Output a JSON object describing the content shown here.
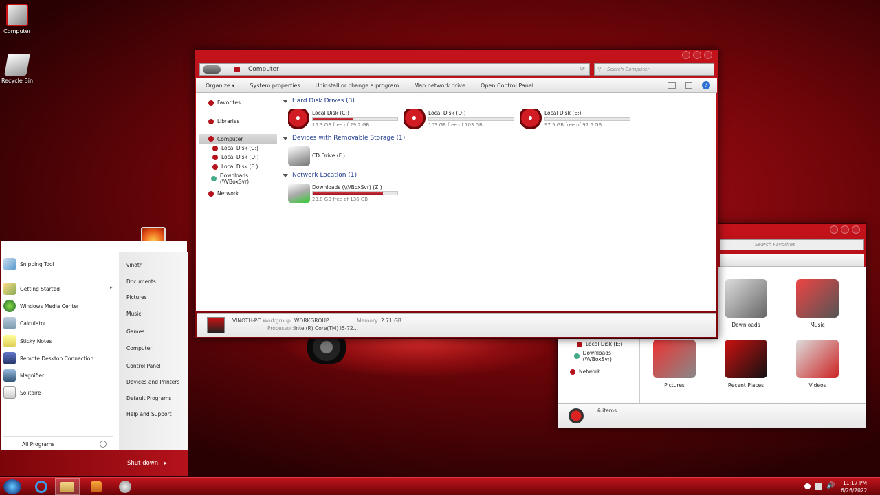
{
  "desktop": {
    "computer": "Computer",
    "recycle": "Recycle Bin"
  },
  "explorer": {
    "address": "Computer",
    "search_placeholder": "Search Computer",
    "toolbar": [
      "Organize",
      "System properties",
      "Uninstall or change a program",
      "Map network drive",
      "Open Control Panel"
    ],
    "organize_arrow": "▾",
    "nav": {
      "favorites": "Favorites",
      "libraries": "Libraries",
      "computer": "Computer",
      "c": "Local Disk (C:)",
      "d": "Local Disk (D:)",
      "e": "Local Disk (E:)",
      "downloads": "Downloads (\\\\VBoxSvr)",
      "network": "Network"
    },
    "groups": {
      "hdd": "Hard Disk Drives (3)",
      "removable": "Devices with Removable Storage (1)",
      "network": "Network Location (1)"
    },
    "drives": [
      {
        "name": "Local Disk (C:)",
        "free": "15.3 GB free of 29.2 GB",
        "used": 0.48
      },
      {
        "name": "Local Disk (D:)",
        "free": "103 GB free of 103 GB",
        "used": 0.0
      },
      {
        "name": "Local Disk (E:)",
        "free": "97.5 GB free of 97.6 GB",
        "used": 0.0
      }
    ],
    "cd": "CD Drive (F:)",
    "netdrive": {
      "name": "Downloads (\\\\VBoxSvr) (Z:)",
      "free": "23.8 GB free of 136 GB",
      "used": 0.83
    },
    "details": {
      "pcname": "VINOTH-PC",
      "workgroup_label": "Workgroup:",
      "workgroup": "WORKGROUP",
      "memory_label": "Memory:",
      "memory": "2.71 GB",
      "processor_label": "Processor:",
      "processor": "Intel(R) Core(TM) i5-72..."
    }
  },
  "favorites_window": {
    "search_placeholder": "Search Favorites",
    "nav": {
      "e": "Local Disk (E:)",
      "downloads": "Downloads (\\\\VBoxSvr)",
      "network": "Network"
    },
    "tiles": [
      "Downloads",
      "Music",
      "Pictures",
      "Recent Places",
      "Videos"
    ],
    "status": "6 items"
  },
  "start": {
    "left": [
      "Snipping Tool",
      "Getting Started",
      "Windows Media Center",
      "Calculator",
      "Sticky Notes",
      "Remote Desktop Connection",
      "Magnifier",
      "Solitaire"
    ],
    "right": [
      "vinoth",
      "Documents",
      "Pictures",
      "Music",
      "Games",
      "Computer",
      "Control Panel",
      "Devices and Printers",
      "Default Programs",
      "Help and Support"
    ],
    "all_programs": "All Programs",
    "shutdown": "Shut down",
    "arrow": "▸"
  },
  "taskbar": {
    "time": "11:17 PM",
    "date": "6/26/2022"
  },
  "colors": {
    "accent": "#b5121b",
    "link": "#1e3b8a"
  }
}
